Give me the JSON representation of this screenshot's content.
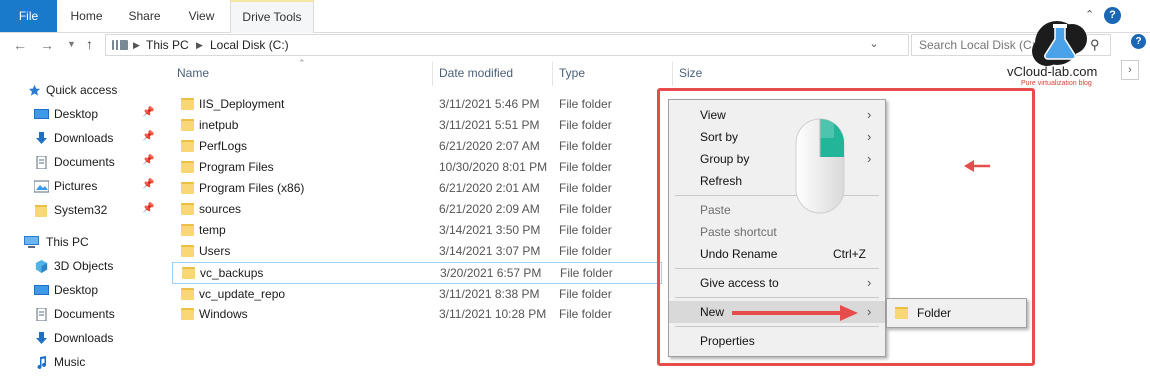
{
  "ribbon": {
    "tabs": [
      "File",
      "Home",
      "Share",
      "View",
      "Drive Tools"
    ],
    "help": "?"
  },
  "address": {
    "crumbs": [
      "This PC",
      "Local Disk (C:)"
    ],
    "search_placeholder": "Search Local Disk (C:)"
  },
  "logo": {
    "name": "vCloud-lab.com",
    "tagline": "Pure virtualization blog"
  },
  "sidebar": {
    "quick_access": "Quick access",
    "quick_items": [
      "Desktop",
      "Downloads",
      "Documents",
      "Pictures",
      "System32"
    ],
    "this_pc": "This PC",
    "pc_items": [
      "3D Objects",
      "Desktop",
      "Documents",
      "Downloads",
      "Music"
    ]
  },
  "columns": {
    "name": "Name",
    "date": "Date modified",
    "type": "Type",
    "size": "Size"
  },
  "files": [
    {
      "name": "IIS_Deployment",
      "date": "3/11/2021 5:46 PM",
      "type": "File folder"
    },
    {
      "name": "inetpub",
      "date": "3/11/2021 5:51 PM",
      "type": "File folder"
    },
    {
      "name": "PerfLogs",
      "date": "6/21/2020 2:07 AM",
      "type": "File folder"
    },
    {
      "name": "Program Files",
      "date": "10/30/2020 8:01 PM",
      "type": "File folder"
    },
    {
      "name": "Program Files (x86)",
      "date": "6/21/2020 2:01 AM",
      "type": "File folder"
    },
    {
      "name": "sources",
      "date": "6/21/2020 2:09 AM",
      "type": "File folder"
    },
    {
      "name": "temp",
      "date": "3/14/2021 3:50 PM",
      "type": "File folder"
    },
    {
      "name": "Users",
      "date": "3/14/2021 3:07 PM",
      "type": "File folder"
    },
    {
      "name": "vc_backups",
      "date": "3/20/2021 6:57 PM",
      "type": "File folder"
    },
    {
      "name": "vc_update_repo",
      "date": "3/11/2021 8:38 PM",
      "type": "File folder"
    },
    {
      "name": "Windows",
      "date": "3/11/2021 10:28 PM",
      "type": "File folder"
    }
  ],
  "context_menu": {
    "view": "View",
    "sort_by": "Sort by",
    "group_by": "Group by",
    "refresh": "Refresh",
    "paste": "Paste",
    "paste_shortcut": "Paste shortcut",
    "undo_rename": "Undo Rename",
    "undo_shortcut": "Ctrl+Z",
    "give_access": "Give access to",
    "new": "New",
    "properties": "Properties"
  },
  "submenu": {
    "folder": "Folder"
  },
  "colors": {
    "accent": "#1979ca",
    "annotation": "#e74c4c",
    "highlight": "#fff84a",
    "folder": "#f8d774"
  }
}
